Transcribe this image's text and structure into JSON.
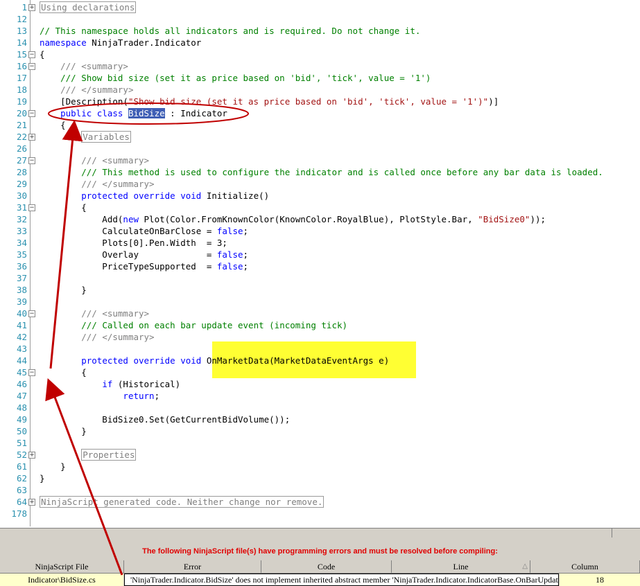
{
  "editor": {
    "lines": [
      {
        "num": "1",
        "fold": "+",
        "segs": [
          {
            "t": "Using declarations",
            "c": "region"
          }
        ]
      },
      {
        "num": "12",
        "segs": []
      },
      {
        "num": "13",
        "segs": [
          {
            "t": "// This namespace holds all indicators and is required. Do not change it.",
            "c": "cm"
          }
        ]
      },
      {
        "num": "14",
        "segs": [
          {
            "t": "namespace",
            "c": "kw"
          },
          {
            "t": " NinjaTrader.Indicator"
          }
        ]
      },
      {
        "num": "15",
        "fold": "-",
        "segs": [
          {
            "t": "{"
          }
        ]
      },
      {
        "num": "16",
        "fold": "-",
        "segs": [
          {
            "t": "    "
          },
          {
            "t": "/// <summary>",
            "c": "gr"
          }
        ]
      },
      {
        "num": "17",
        "segs": [
          {
            "t": "    "
          },
          {
            "t": "/// Show bid size (set it as price based on 'bid', 'tick', value = '1')",
            "c": "cm"
          }
        ]
      },
      {
        "num": "18",
        "segs": [
          {
            "t": "    "
          },
          {
            "t": "/// </summary>",
            "c": "gr"
          }
        ]
      },
      {
        "num": "19",
        "segs": [
          {
            "t": "    [Description("
          },
          {
            "t": "\"Show bid size (set it as price based on 'bid', 'tick', value = '1')\"",
            "c": "st"
          },
          {
            "t": ")]"
          }
        ]
      },
      {
        "num": "20",
        "fold": "-",
        "segs": [
          {
            "t": "    "
          },
          {
            "t": "public class",
            "c": "kw"
          },
          {
            "t": " "
          },
          {
            "t": "BidSize",
            "c": "sel"
          },
          {
            "t": " : Indicator"
          }
        ]
      },
      {
        "num": "21",
        "segs": [
          {
            "t": "    {"
          }
        ]
      },
      {
        "num": "22",
        "fold": "+",
        "segs": [
          {
            "t": "        "
          },
          {
            "t": "Variables",
            "c": "region"
          }
        ]
      },
      {
        "num": "26",
        "segs": []
      },
      {
        "num": "27",
        "fold": "-",
        "segs": [
          {
            "t": "        "
          },
          {
            "t": "/// <summary>",
            "c": "gr"
          }
        ]
      },
      {
        "num": "28",
        "segs": [
          {
            "t": "        "
          },
          {
            "t": "/// This method is used to configure the indicator and is called once before any bar data is loaded.",
            "c": "cm"
          }
        ]
      },
      {
        "num": "29",
        "segs": [
          {
            "t": "        "
          },
          {
            "t": "/// </summary>",
            "c": "gr"
          }
        ]
      },
      {
        "num": "30",
        "segs": [
          {
            "t": "        "
          },
          {
            "t": "protected override void",
            "c": "kw"
          },
          {
            "t": " Initialize()"
          }
        ]
      },
      {
        "num": "31",
        "fold": "-",
        "segs": [
          {
            "t": "        {"
          }
        ]
      },
      {
        "num": "32",
        "segs": [
          {
            "t": "            Add("
          },
          {
            "t": "new",
            "c": "kw"
          },
          {
            "t": " Plot(Color.FromKnownColor(KnownColor.RoyalBlue), PlotStyle.Bar, "
          },
          {
            "t": "\"BidSize0\"",
            "c": "st"
          },
          {
            "t": "));"
          }
        ]
      },
      {
        "num": "33",
        "segs": [
          {
            "t": "            CalculateOnBarClose = "
          },
          {
            "t": "false",
            "c": "kw"
          },
          {
            "t": ";"
          }
        ]
      },
      {
        "num": "34",
        "segs": [
          {
            "t": "            Plots[0].Pen.Width  = 3;"
          }
        ]
      },
      {
        "num": "35",
        "segs": [
          {
            "t": "            Overlay             = "
          },
          {
            "t": "false",
            "c": "kw"
          },
          {
            "t": ";"
          }
        ]
      },
      {
        "num": "36",
        "segs": [
          {
            "t": "            PriceTypeSupported  = "
          },
          {
            "t": "false",
            "c": "kw"
          },
          {
            "t": ";"
          }
        ]
      },
      {
        "num": "37",
        "segs": []
      },
      {
        "num": "38",
        "segs": [
          {
            "t": "        }"
          }
        ]
      },
      {
        "num": "39",
        "segs": []
      },
      {
        "num": "40",
        "fold": "-",
        "segs": [
          {
            "t": "        "
          },
          {
            "t": "/// <summary>",
            "c": "gr"
          }
        ]
      },
      {
        "num": "41",
        "segs": [
          {
            "t": "        "
          },
          {
            "t": "/// Called on each bar update event (incoming tick)",
            "c": "cm"
          }
        ]
      },
      {
        "num": "42",
        "segs": [
          {
            "t": "        "
          },
          {
            "t": "/// </summary>",
            "c": "gr"
          }
        ]
      },
      {
        "num": "43",
        "segs": []
      },
      {
        "num": "44",
        "segs": [
          {
            "t": "        "
          },
          {
            "t": "protected override void",
            "c": "kw"
          },
          {
            "t": " OnMarketData(MarketDataEventArgs e)"
          }
        ]
      },
      {
        "num": "45",
        "fold": "-",
        "segs": [
          {
            "t": "        {"
          }
        ]
      },
      {
        "num": "46",
        "segs": [
          {
            "t": "            "
          },
          {
            "t": "if",
            "c": "kw"
          },
          {
            "t": " (Historical)"
          }
        ]
      },
      {
        "num": "47",
        "segs": [
          {
            "t": "                "
          },
          {
            "t": "return",
            "c": "kw"
          },
          {
            "t": ";"
          }
        ]
      },
      {
        "num": "48",
        "segs": []
      },
      {
        "num": "49",
        "segs": [
          {
            "t": "            BidSize0.Set(GetCurrentBidVolume());"
          }
        ]
      },
      {
        "num": "50",
        "segs": [
          {
            "t": "        }"
          }
        ]
      },
      {
        "num": "51",
        "segs": []
      },
      {
        "num": "52",
        "fold": "+",
        "segs": [
          {
            "t": "        "
          },
          {
            "t": "Properties",
            "c": "region"
          }
        ]
      },
      {
        "num": "61",
        "segs": [
          {
            "t": "    }"
          }
        ]
      },
      {
        "num": "62",
        "segs": [
          {
            "t": "}"
          }
        ]
      },
      {
        "num": "63",
        "segs": []
      },
      {
        "num": "64",
        "fold": "+",
        "segs": [
          {
            "t": "NinjaScript generated code. Neither change nor remove.",
            "c": "region"
          }
        ]
      },
      {
        "num": "178",
        "segs": []
      }
    ]
  },
  "errors": {
    "banner": "The following NinjaScript file(s) have programming errors and must be resolved before compiling:",
    "columns": [
      "NinjaScript File",
      "Error",
      "Code",
      "Line",
      "Column"
    ],
    "rows": [
      {
        "file": "Indicator\\BidSize.cs",
        "error": "'NinjaTrader.Indicator.BidSize' does not implement inherited abstract member 'NinjaTrader.Indicator.IndicatorBase.OnBarUpdate()'",
        "code": "",
        "line": "",
        "column": "18"
      }
    ]
  },
  "colors": {
    "keyword": "#0000ff",
    "comment": "#008000",
    "string": "#a31515",
    "line_number": "#2b91af",
    "highlight": "#ffff33",
    "annotation": "#c00000",
    "error_text": "#e00000"
  }
}
